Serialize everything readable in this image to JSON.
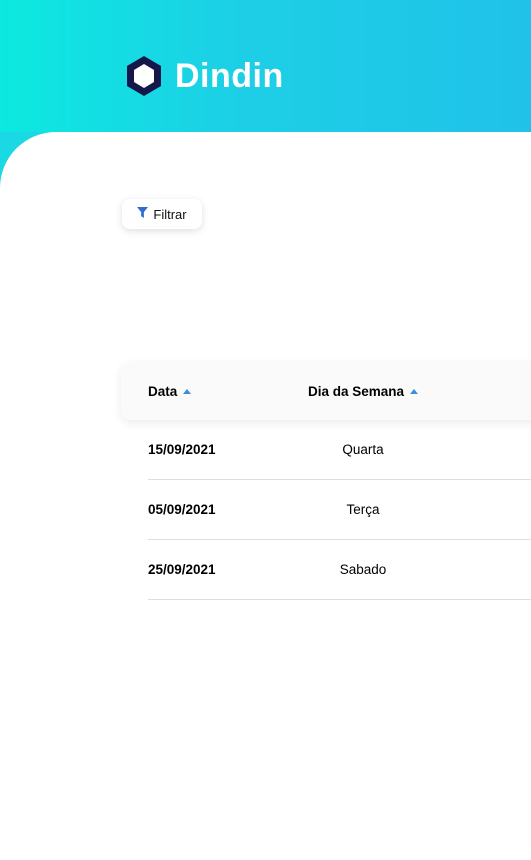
{
  "brand": {
    "name": "Dindin",
    "logo_icon": "hexagon-logo-icon"
  },
  "colors": {
    "header_start": "#0ce9e0",
    "header_end": "#20c2e8",
    "sort_arrow": "#3a8fd8",
    "logo_dark": "#15174a"
  },
  "toolbar": {
    "filter_label": "Filtrar",
    "filter_icon": "funnel-icon"
  },
  "table": {
    "columns": [
      {
        "label": "Data",
        "sort": "ascending"
      },
      {
        "label": "Dia da Semana",
        "sort": "ascending"
      }
    ],
    "rows": [
      {
        "date": "15/09/2021",
        "weekday": "Quarta"
      },
      {
        "date": "05/09/2021",
        "weekday": "Terça"
      },
      {
        "date": "25/09/2021",
        "weekday": "Sabado"
      }
    ]
  }
}
